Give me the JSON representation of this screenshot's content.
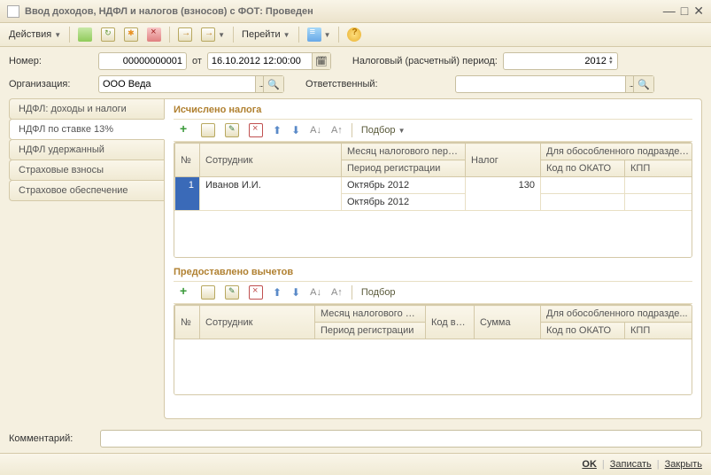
{
  "window": {
    "title": "Ввод доходов, НДФЛ и налогов (взносов) с ФОТ: Проведен"
  },
  "toolbar": {
    "actions": "Действия",
    "goto": "Перейти"
  },
  "fields": {
    "number_label": "Номер:",
    "number_value": "00000000001",
    "date_from": "от",
    "date_value": "16.10.2012 12:00:00",
    "tax_period_label": "Налоговый (расчетный) период:",
    "tax_period_value": "2012",
    "org_label": "Организация:",
    "org_value": "ООО Веда",
    "resp_label": "Ответственный:",
    "resp_value": ""
  },
  "tabs": {
    "items": [
      {
        "label": "НДФЛ: доходы и налоги"
      },
      {
        "label": "НДФЛ по ставке 13%"
      },
      {
        "label": "НДФЛ удержанный"
      },
      {
        "label": "Страховые взносы"
      },
      {
        "label": "Страховое обеспечение"
      }
    ]
  },
  "section1": {
    "title": "Исчислено налога",
    "podbor": "Подбор",
    "headers": {
      "num": "№",
      "emp": "Сотрудник",
      "month": "Месяц налогового пери...",
      "period": "Период регистрации",
      "tax": "Налог",
      "subdiv": "Для обособленного подразделения",
      "okato": "Код по ОКАТО",
      "kpp": "КПП"
    },
    "rows": [
      {
        "n": "1",
        "emp": "Иванов И.И.",
        "month": "Октябрь 2012",
        "period": "Октябрь 2012",
        "tax": "130",
        "okato": "",
        "kpp": ""
      }
    ]
  },
  "section2": {
    "title": "Предоставлено вычетов",
    "podbor": "Подбор",
    "headers": {
      "num": "№",
      "emp": "Сотрудник",
      "month": "Месяц налогового пе...",
      "period": "Период регистрации",
      "code": "Код вычета",
      "sum": "Сумма",
      "subdiv": "Для обособленного подразде...",
      "okato": "Код по ОКАТО",
      "kpp": "КПП"
    }
  },
  "footer": {
    "comment_label": "Комментарий:",
    "comment_value": ""
  },
  "buttons": {
    "ok": "OK",
    "save": "Записать",
    "close": "Закрыть"
  }
}
